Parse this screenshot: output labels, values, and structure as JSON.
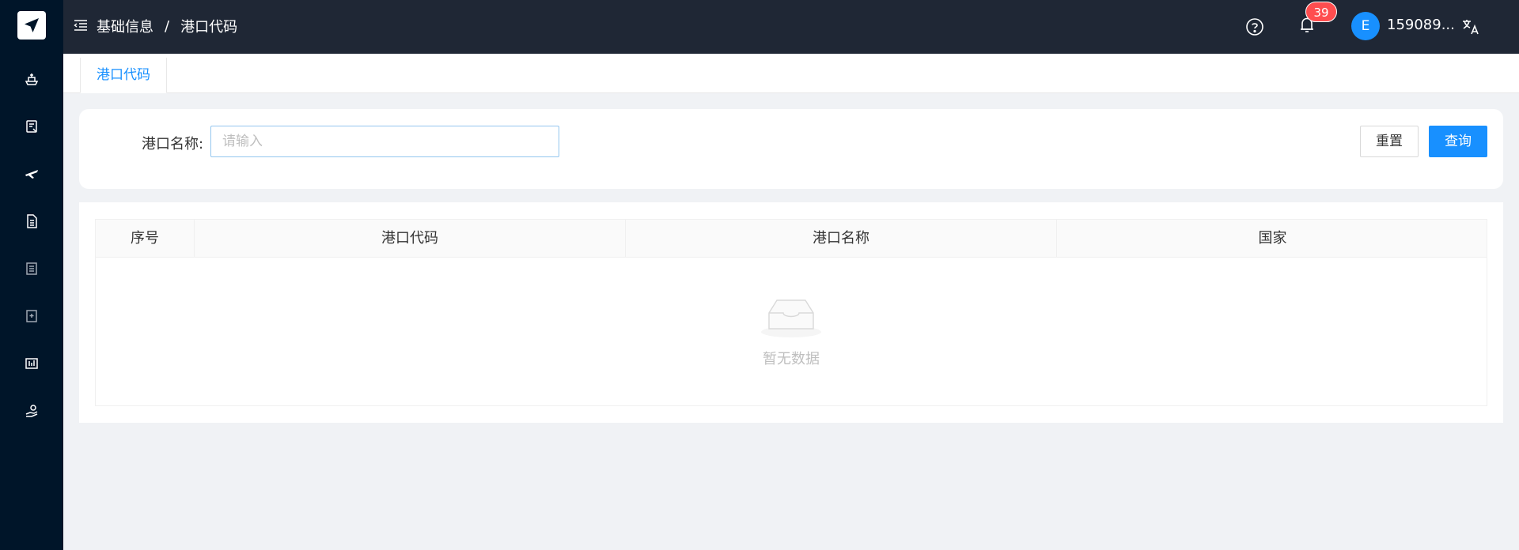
{
  "sidebar": {
    "items": [
      {
        "icon": "ship-icon"
      },
      {
        "icon": "document-edit-icon"
      },
      {
        "icon": "airplane-icon"
      },
      {
        "icon": "file-text-icon"
      },
      {
        "icon": "list-icon"
      },
      {
        "icon": "bookmark-add-icon"
      },
      {
        "icon": "dashboard-icon"
      },
      {
        "icon": "hand-coin-icon"
      }
    ]
  },
  "header": {
    "breadcrumb": [
      "基础信息",
      "/",
      "港口代码"
    ],
    "notification_count": "39",
    "avatar_initial": "E",
    "username": "159089..."
  },
  "tabs": [
    {
      "label": "港口代码"
    }
  ],
  "search": {
    "label": "港口名称:",
    "placeholder": "请输入",
    "value": "",
    "reset_label": "重置",
    "query_label": "查询"
  },
  "table": {
    "columns": [
      "序号",
      "港口代码",
      "港口名称",
      "国家"
    ],
    "rows": [],
    "empty_text": "暂无数据"
  },
  "colors": {
    "primary": "#1890ff",
    "sidebar_bg": "#001529",
    "header_bg": "#1f2735",
    "badge": "#ff4d4f"
  }
}
